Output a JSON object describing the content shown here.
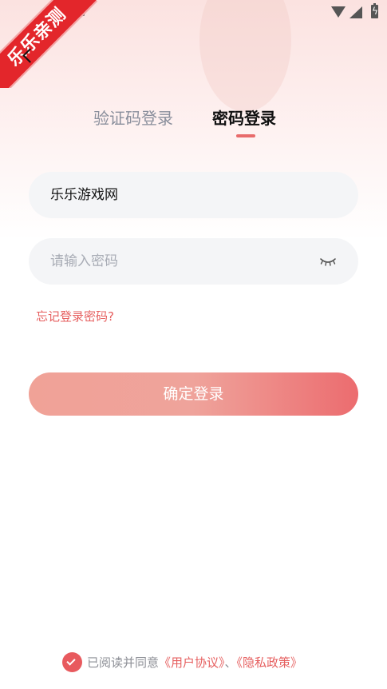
{
  "header": {
    "ribbon_text": "乐乐亲测"
  },
  "tabs": [
    {
      "label": "验证码登录",
      "active": false
    },
    {
      "label": "密码登录",
      "active": true
    }
  ],
  "form": {
    "account_value": "乐乐游戏网",
    "password_placeholder": "请输入密码",
    "forgot_label": "忘记登录密码?",
    "submit_label": "确定登录"
  },
  "agreement": {
    "prefix": "已阅读并同意",
    "user_agreement": "《用户协议》",
    "separator": "、",
    "privacy_policy": "《隐私政策》",
    "checked": true
  },
  "icons": [
    "back-arrow-icon",
    "eye-closed-icon",
    "check-icon",
    "wifi-icon",
    "signal-icon",
    "battery-icon",
    "keyboard-icon"
  ],
  "colors": {
    "accent": "#e65f5f",
    "button_start": "#f0a297",
    "button_end": "#ec6c6f",
    "field_bg": "#f4f5f7"
  }
}
